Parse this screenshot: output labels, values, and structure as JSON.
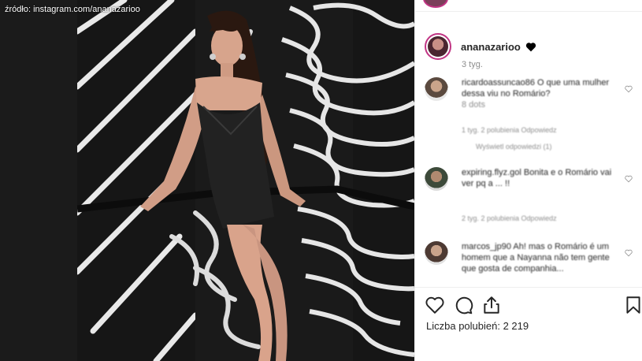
{
  "source_caption": "źródło: instagram.com/ananazarioo",
  "post": {
    "author": "ananazarioo",
    "author_badge_icon": "black-heart-icon",
    "age": "3 tyg."
  },
  "comments": [
    {
      "text": "ricardoassuncao86 O que uma mulher dessa viu no Romário?",
      "sub": "8 dots",
      "meta": "1 tyg.     2 polubienia     Odpowiedz",
      "replies": "Wyświetl odpowiedzi (1)"
    },
    {
      "text": "expiring.flyz.gol Bonita e o Romário vai ver pq a ... !!",
      "meta": "2 tyg.     2 polubienia     Odpowiedz"
    },
    {
      "text": "marcos_jp90 Ah! mas o Romário é um homem que a Nayanna não tem gente que gosta de companhia...",
      "meta": ""
    }
  ],
  "likes_text": "Liczba polubień: 2 219",
  "icons": {
    "like": "heart-outline-icon",
    "comment": "comment-icon",
    "share": "share-icon",
    "save": "bookmark-icon"
  },
  "colors": {
    "story_ring": "#c13584",
    "secondary_text": "#8e8e8e",
    "primary_text": "#262626"
  }
}
